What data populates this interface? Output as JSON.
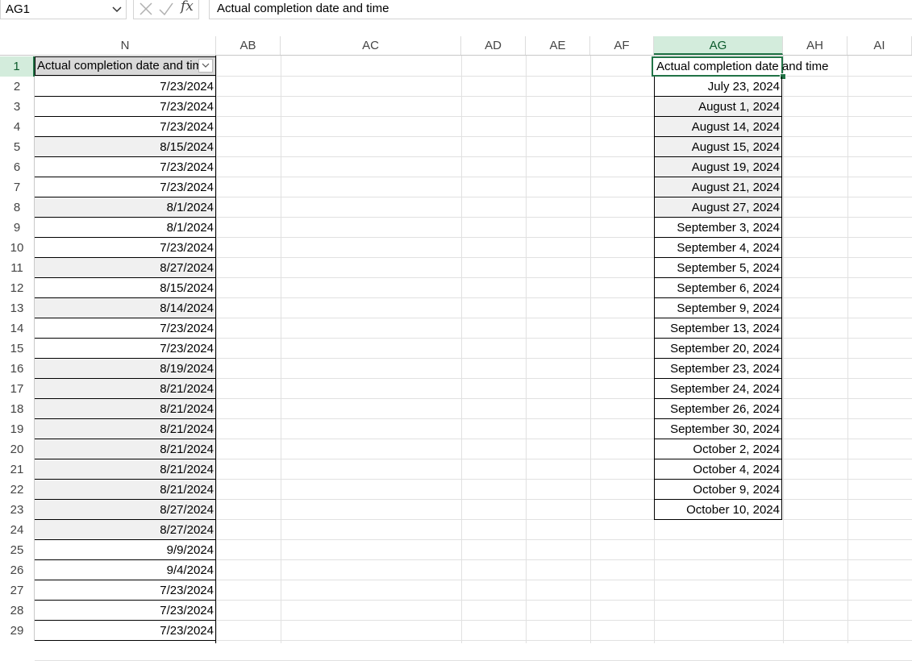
{
  "formula_bar": {
    "name_box": "AG1",
    "formula": "Actual completion date and time"
  },
  "columns": [
    "N",
    "AB",
    "AC",
    "AD",
    "AE",
    "AF",
    "AG",
    "AH",
    "AI"
  ],
  "selected_column": "AG",
  "rows": [
    "1",
    "2",
    "3",
    "4",
    "5",
    "6",
    "7",
    "8",
    "9",
    "10",
    "11",
    "12",
    "13",
    "14",
    "15",
    "16",
    "17",
    "18",
    "19",
    "20",
    "21",
    "22",
    "23",
    "24",
    "25",
    "26",
    "27",
    "28",
    "29"
  ],
  "column_n": {
    "header": "Actual completion date and time",
    "values": [
      "7/23/2024",
      "7/23/2024",
      "7/23/2024",
      "8/15/2024",
      "7/23/2024",
      "7/23/2024",
      "8/1/2024",
      "8/1/2024",
      "7/23/2024",
      "8/27/2024",
      "8/15/2024",
      "8/14/2024",
      "7/23/2024",
      "7/23/2024",
      "8/19/2024",
      "8/21/2024",
      "8/21/2024",
      "8/21/2024",
      "8/21/2024",
      "8/21/2024",
      "8/21/2024",
      "8/27/2024",
      "8/27/2024",
      "9/9/2024",
      "9/4/2024",
      "7/23/2024",
      "7/23/2024",
      "7/23/2024"
    ]
  },
  "column_ag": {
    "header": "Actual completion date and time",
    "values": [
      "July 23, 2024",
      "August 1, 2024",
      "August 14, 2024",
      "August 15, 2024",
      "August 19, 2024",
      "August 21, 2024",
      "August 27, 2024",
      "September 3, 2024",
      "September 4, 2024",
      "September 5, 2024",
      "September 6, 2024",
      "September 9, 2024",
      "September 13, 2024",
      "September 20, 2024",
      "September 23, 2024",
      "September 24, 2024",
      "September 26, 2024",
      "September 30, 2024",
      "October 2, 2024",
      "October 4, 2024",
      "October 9, 2024",
      "October 10, 2024"
    ]
  },
  "colors": {
    "selection": "#217346",
    "selected_header_bg": "#d3ecdc",
    "gray_fill": "#f0f0f0"
  }
}
